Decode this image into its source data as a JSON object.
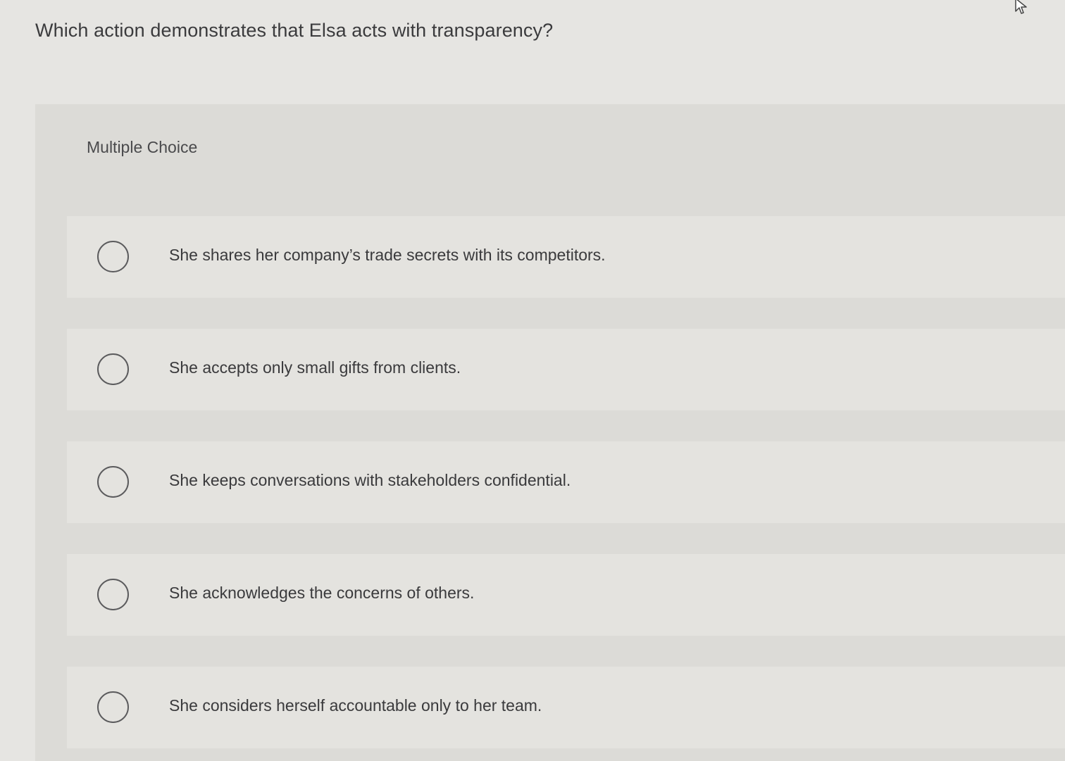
{
  "question": {
    "text": "Which action demonstrates that Elsa acts with transparency?"
  },
  "question_type": "Multiple Choice",
  "options": [
    {
      "label": "She shares her company’s trade secrets with its competitors.",
      "selected": false
    },
    {
      "label": "She accepts only small gifts from clients.",
      "selected": false
    },
    {
      "label": "She keeps conversations with stakeholders confidential.",
      "selected": false
    },
    {
      "label": "She acknowledges the concerns of others.",
      "selected": false
    },
    {
      "label": "She considers herself accountable only to her team.",
      "selected": false
    }
  ],
  "colors": {
    "page_background": "#e6e5e2",
    "panel_background": "#dcdbd7",
    "option_background": "#e4e3df",
    "text": "#3a3a3c",
    "radio_border": "#5b5b5d"
  },
  "icons": {
    "cursor": "mouse-pointer-icon",
    "radio": "radio-button-icon"
  }
}
